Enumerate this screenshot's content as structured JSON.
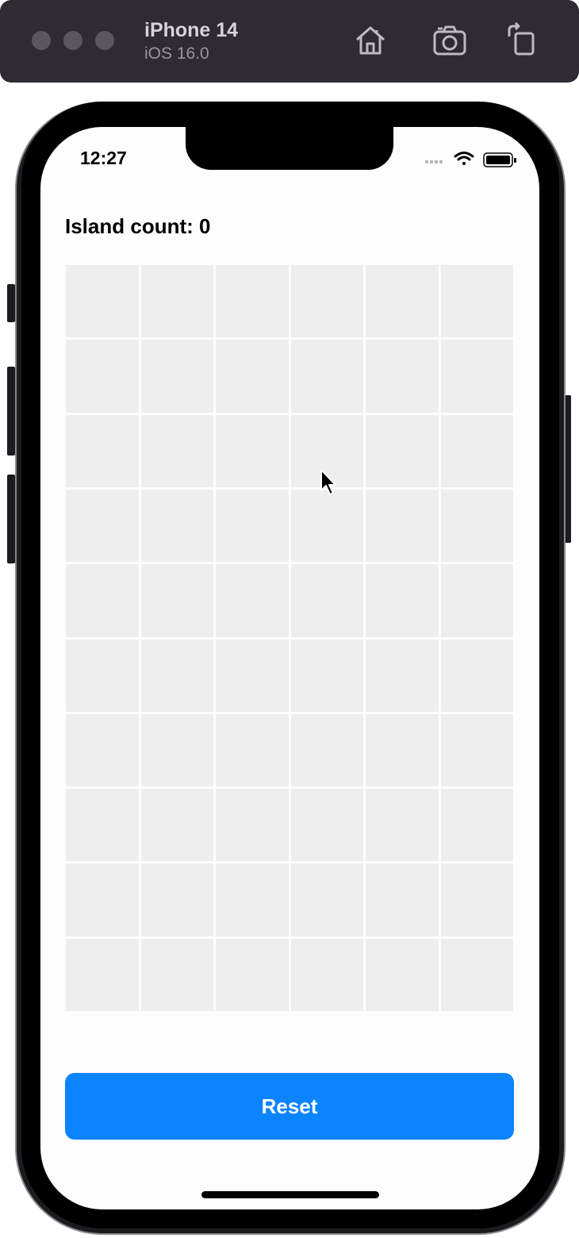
{
  "simulator": {
    "device_name": "iPhone 14",
    "os_version": "iOS 16.0",
    "icons": [
      "home-icon",
      "screenshot-icon",
      "rotate-icon"
    ]
  },
  "status_bar": {
    "time": "12:27",
    "icons": [
      "signal-icon",
      "wifi-icon",
      "battery-icon"
    ]
  },
  "app": {
    "island_count_label": "Island count: 0",
    "grid": {
      "rows": 10,
      "columns": 6,
      "cell_color": "#eeeeee"
    },
    "reset_label": "Reset"
  },
  "colors": {
    "accent": "#0a84ff",
    "toolbar": "#2e2b33"
  }
}
